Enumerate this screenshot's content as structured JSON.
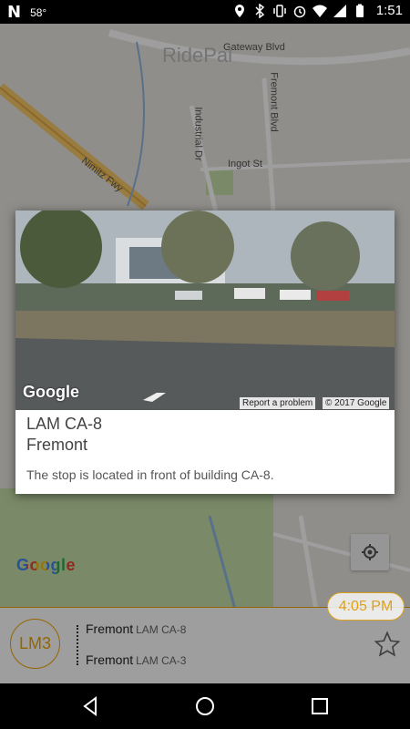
{
  "status_bar": {
    "notification_icon": "N",
    "temperature": "58°",
    "time": "1:51",
    "icons": [
      "location-icon",
      "bluetooth-icon",
      "vibrate-icon",
      "alarm-icon",
      "wifi-icon",
      "signal-icon",
      "battery-icon"
    ]
  },
  "map": {
    "labels": {
      "road_1": "Nimitz Fwy",
      "road_2": "Industrial Dr",
      "road_3": "Ingot St",
      "road_4": "Fremont Blvd",
      "road_5": "Gateway Blvd",
      "watermark": "RidePal"
    },
    "logo": "Google"
  },
  "popup": {
    "photo": {
      "logo": "Google",
      "report": "Report a problem",
      "copyright": "© 2017 Google"
    },
    "title": "LAM CA-8",
    "subtitle": "Fremont",
    "description": "The stop is located in front of building CA-8."
  },
  "route": {
    "time": "4:05 PM",
    "badge": "LM3",
    "stops": [
      {
        "city": "Fremont",
        "code": "LAM CA-8"
      },
      {
        "city": "Fremont",
        "code": "LAM CA-3"
      }
    ]
  },
  "colors": {
    "accent": "#f0a500"
  }
}
